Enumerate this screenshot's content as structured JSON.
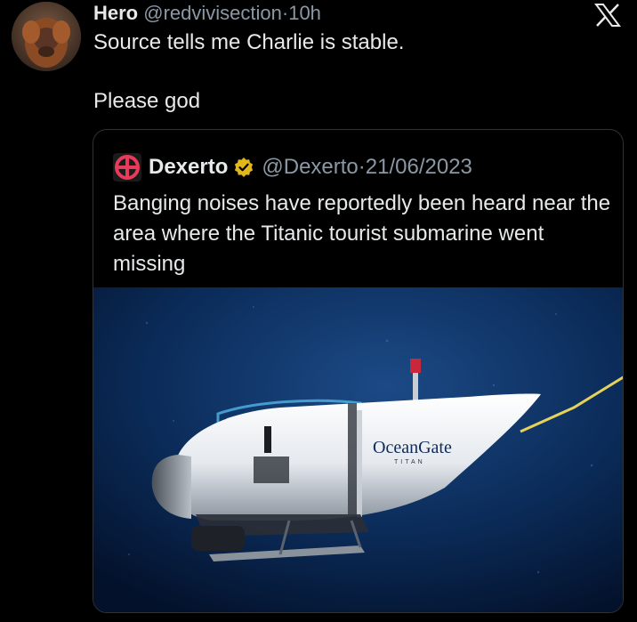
{
  "tweet": {
    "author_name": "Hero",
    "handle": "@redvivisection",
    "separator": "·",
    "time": "10h",
    "text_line1": "Source tells me Charlie is stable.",
    "text_line2": "Please god"
  },
  "quoted": {
    "author_name": "Dexerto",
    "handle": "@Dexerto",
    "separator": "·",
    "date": "21/06/2023",
    "text": "Banging noises have reportedly been heard near the area where the Titanic tourist submarine went missing",
    "image": {
      "brand": "OceanGate",
      "sub": "TITAN"
    }
  },
  "icons": {
    "platform": "x-logo-icon",
    "verified": "verified-badge-icon",
    "publisher_logo": "dexerto-logo-icon"
  },
  "colors": {
    "background": "#000000",
    "text": "#e7e9ea",
    "muted": "#8b98a5",
    "verified_gold": "#e2b719",
    "dexerto_red": "#e83a5a",
    "ocean_blue": "#0b2c5a"
  }
}
